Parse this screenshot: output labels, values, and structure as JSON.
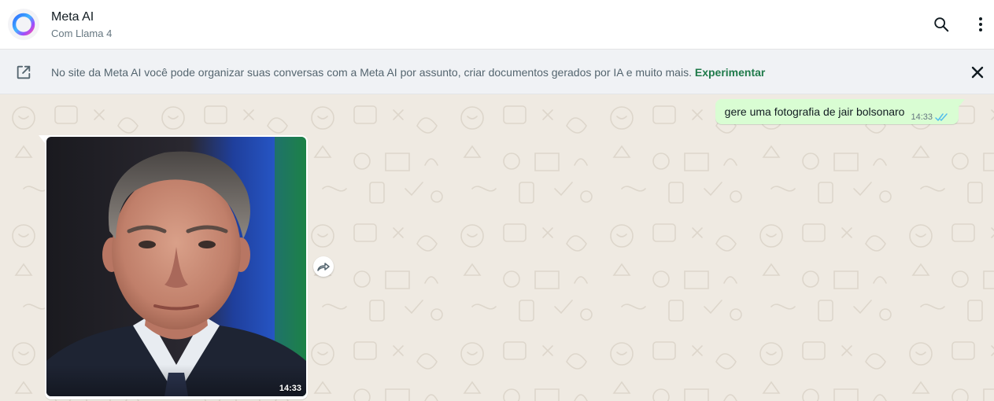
{
  "header": {
    "title": "Meta AI",
    "subtitle": "Com Llama 4",
    "avatar_icon": "meta-ai-ring-icon",
    "search_icon": "search-icon",
    "menu_icon": "kebab-menu-icon"
  },
  "banner": {
    "icon": "open-external-icon",
    "text": "No site da Meta AI você pode organizar suas conversas com a Meta AI por assunto, criar documentos gerados por IA e muito mais.",
    "link_label": "Experimentar",
    "close_icon": "close-icon"
  },
  "messages": [
    {
      "direction": "outgoing",
      "text": "gere uma fotografia de jair bolsonaro",
      "time": "14:33",
      "status": "read"
    },
    {
      "direction": "incoming",
      "type": "image",
      "image_subject": "portrait-photo",
      "time": "14:33"
    }
  ],
  "forward_icon": "forward-icon",
  "colors": {
    "chat_bg": "#efeae2",
    "outgoing_bubble": "#d9fdd3",
    "link_green": "#1f7a4a",
    "read_tick": "#53bdeb"
  }
}
